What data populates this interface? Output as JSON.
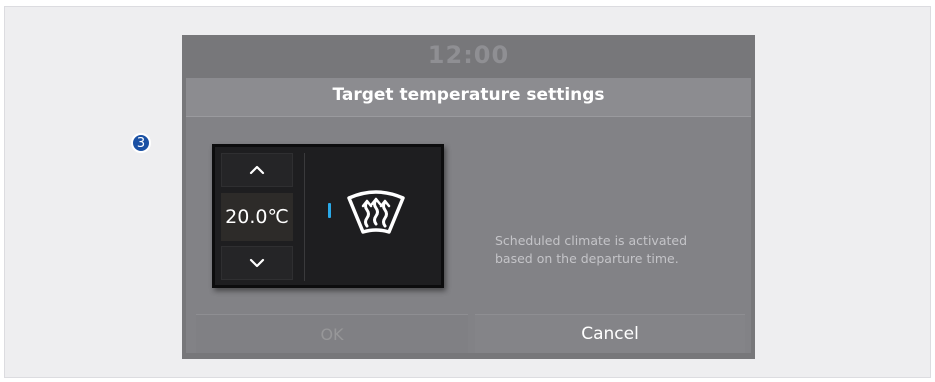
{
  "status_bar": {
    "clock": "12:00"
  },
  "dialog": {
    "title": "Target temperature settings",
    "temperature": "20.0℃",
    "up_icon": "chevron-up-icon",
    "down_icon": "chevron-down-icon",
    "defrost_icon": "front-defroster-icon",
    "callout_number": "3",
    "message_lines": [
      "Scheduled climate is activated",
      "based on the departure time."
    ],
    "ok_label": "OK",
    "cancel_label": "Cancel"
  },
  "colors": {
    "screen_bg": "#77777a",
    "panel_bg": "#1e1e20",
    "indicator_led": "#2aa9e8",
    "callout_badge": "#1b51a4"
  }
}
